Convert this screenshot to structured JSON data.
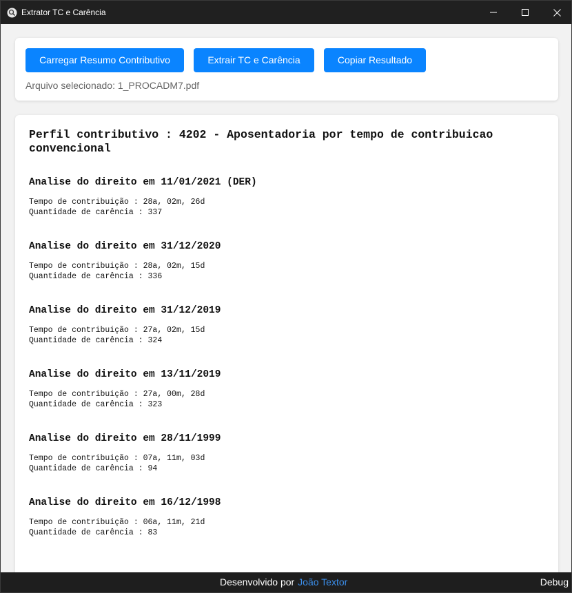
{
  "window": {
    "title": "Extrator TC e Carência"
  },
  "toolbar": {
    "load_label": "Carregar Resumo Contributivo",
    "extract_label": "Extrair TC e Carência",
    "copy_label": "Copiar Resultado",
    "selected_file": "Arquivo selecionado: 1_PROCADM7.pdf",
    "button_color": "#0a84ff"
  },
  "result": {
    "profile_title": "Perfil contributivo : 4202 - Aposentadoria por tempo de contribuicao convencional",
    "analyses": [
      {
        "heading": "Analise do direito em 11/01/2021 (DER)",
        "tempo": "Tempo de contribuição : 28a, 02m, 26d",
        "carencia": "Quantidade de carência : 337"
      },
      {
        "heading": "Analise do direito em 31/12/2020",
        "tempo": "Tempo de contribuição : 28a, 02m, 15d",
        "carencia": "Quantidade de carência : 336"
      },
      {
        "heading": "Analise do direito em 31/12/2019",
        "tempo": "Tempo de contribuição : 27a, 02m, 15d",
        "carencia": "Quantidade de carência : 324"
      },
      {
        "heading": "Analise do direito em 13/11/2019",
        "tempo": "Tempo de contribuição : 27a, 00m, 28d",
        "carencia": "Quantidade de carência : 323"
      },
      {
        "heading": "Analise do direito em 28/11/1999",
        "tempo": "Tempo de contribuição : 07a, 11m, 03d",
        "carencia": "Quantidade de carência : 94"
      },
      {
        "heading": "Analise do direito em 16/12/1998",
        "tempo": "Tempo de contribuição : 06a, 11m, 21d",
        "carencia": "Quantidade de carência : 83"
      }
    ]
  },
  "footer": {
    "developed_by": "Desenvolvido por",
    "author": "João Textor",
    "debug_label": "Debug",
    "link_color": "#3b8eea"
  }
}
